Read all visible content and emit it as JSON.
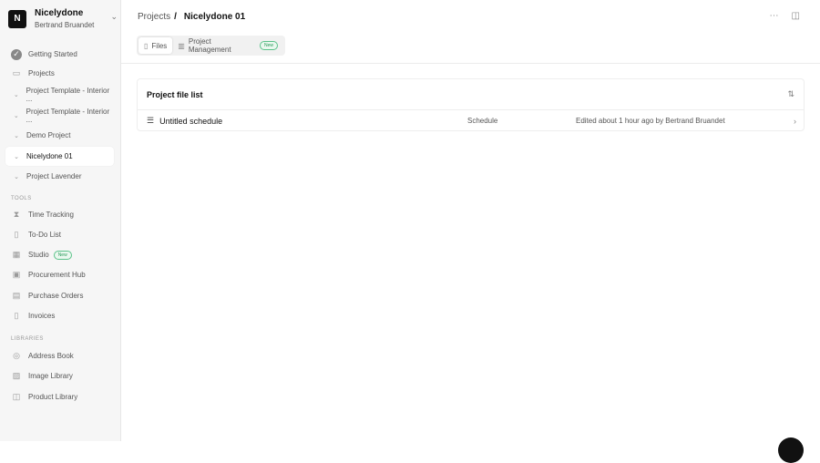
{
  "workspace": {
    "initial": "N",
    "name": "Nicelydone",
    "user": "Bertrand Bruandet"
  },
  "sidebar": {
    "getting_started": "Getting Started",
    "projects": "Projects",
    "project_items": [
      "Project Template - Interior ...",
      "Project Template - Interior ...",
      "Demo Project",
      "Nicelydone 01",
      "Project Lavender"
    ],
    "tools_label": "TOOLS",
    "tools": [
      "Time Tracking",
      "To-Do List",
      "Studio",
      "Procurement Hub",
      "Purchase Orders",
      "Invoices"
    ],
    "new_badge": "New",
    "libraries_label": "LIBRARIES",
    "libraries": [
      "Address Book",
      "Image Library",
      "Product Library"
    ]
  },
  "breadcrumb": {
    "parent": "Projects",
    "sep": "/",
    "current": "Nicelydone 01"
  },
  "tabs": {
    "files": "Files",
    "pm": "Project Management",
    "new": "New"
  },
  "card": {
    "title": "Project file list",
    "rows": [
      {
        "name": "Untitled schedule",
        "type": "Schedule",
        "edited": "Edited about 1 hour ago by Bertrand Bruandet"
      }
    ]
  },
  "colors": {
    "accent": "#111111",
    "badge": "#2a9a5a"
  }
}
